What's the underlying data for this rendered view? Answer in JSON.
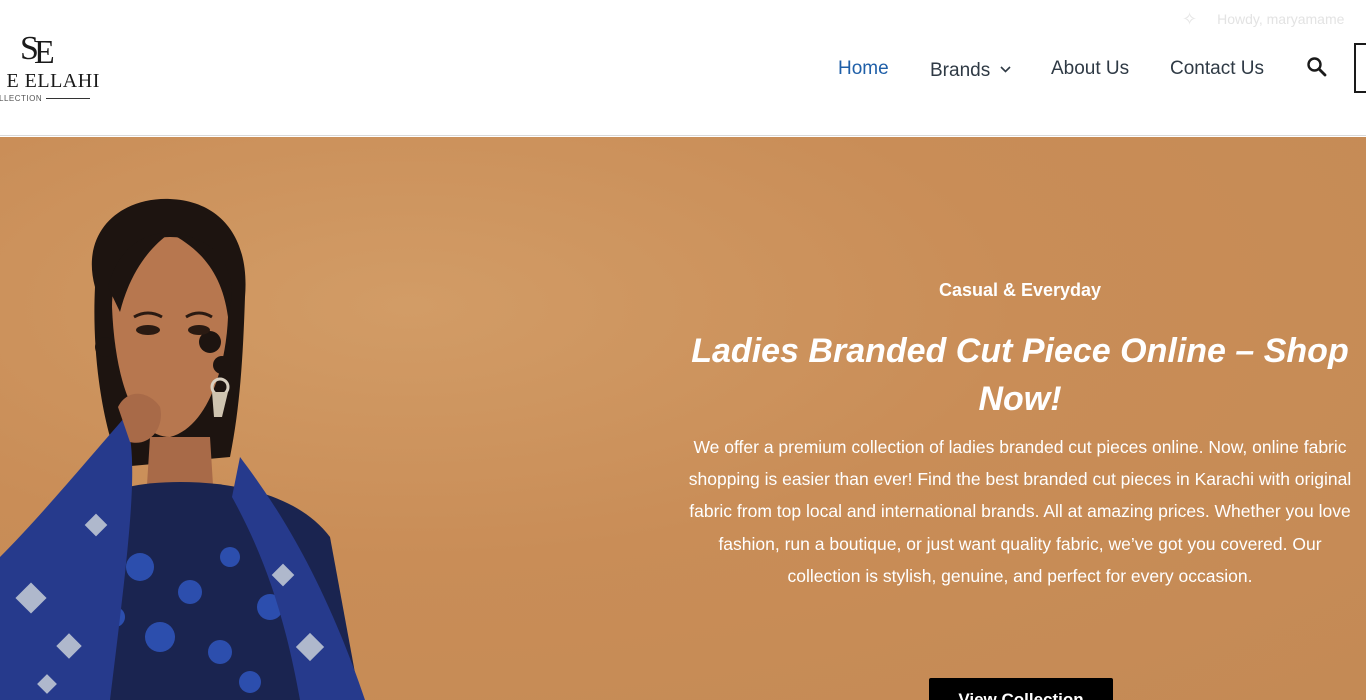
{
  "colors": {
    "nav_active": "#1f5fa8",
    "nav_text": "#2f3a45",
    "hero_background": "#c98d57",
    "cta_background": "#000000",
    "cta_text": "#ffffff"
  },
  "logo": {
    "monogram": "SE",
    "name": "N E ELLAHI",
    "tagline": "COLLECTION"
  },
  "admin_bar": {
    "icon": "sparkle-icon",
    "greeting": "Howdy, maryamame"
  },
  "nav": {
    "items": [
      {
        "label": "Home",
        "active": true
      },
      {
        "label": "Brands",
        "active": false,
        "has_dropdown": true
      },
      {
        "label": "About Us",
        "active": false
      },
      {
        "label": "Contact Us",
        "active": false
      }
    ],
    "search_icon": "search-icon",
    "cart_icon": "cart-icon"
  },
  "hero": {
    "eyebrow": "Casual & Everyday",
    "title": "Ladies Branded Cut Piece Online – Shop Now!",
    "body": "We offer a premium collection of ladies branded cut pieces online. Now, online fabric shopping is easier than ever! Find the best branded cut pieces in Karachi with original fabric from top local and international brands. All at amazing prices. Whether you love fashion, run a boutique, or just want quality fabric, we’ve got you covered. Our collection is stylish, genuine, and perfect for every occasion.",
    "cta_label": "View Collection"
  }
}
